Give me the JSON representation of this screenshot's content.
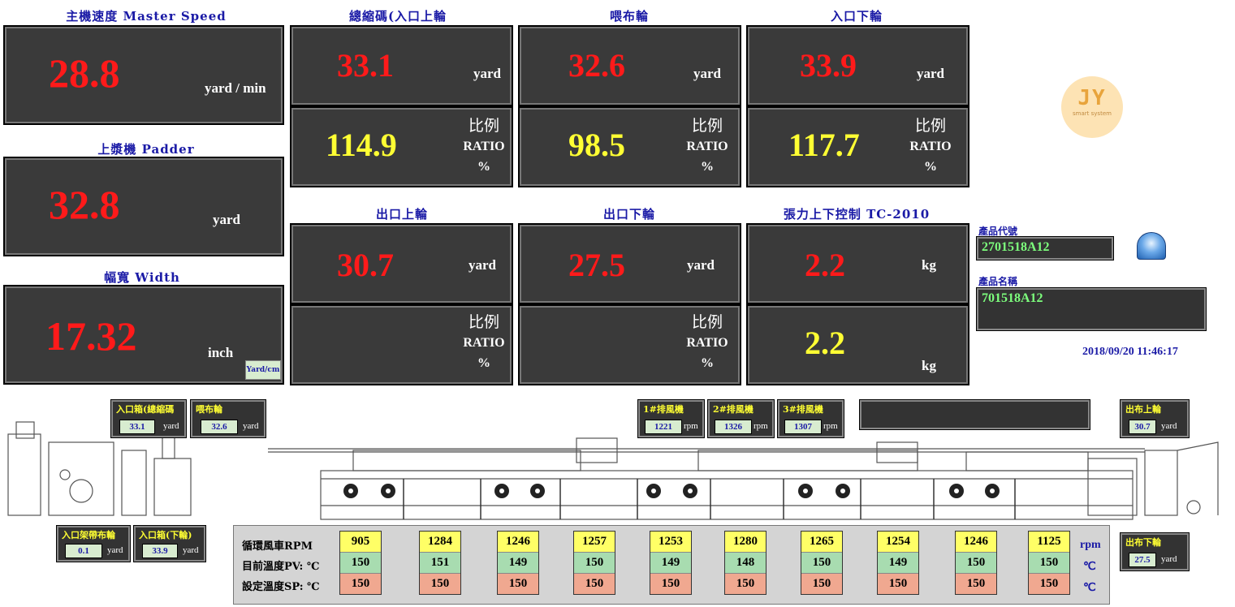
{
  "titles": {
    "master": "主機速度 Master Speed",
    "shrink": "總縮碼(入口上輪",
    "feed": "喂布輪",
    "inlet_lower": "入口下輪",
    "padder": "上漿機 Padder",
    "outlet_upper": "出口上輪",
    "outlet_lower": "出口下輪",
    "tension": "張力上下控制 TC-2010",
    "width": "幅寬 Width"
  },
  "master": {
    "value": "28.8",
    "unit": "yard / min"
  },
  "padder": {
    "value": "32.8",
    "unit": "yard"
  },
  "width": {
    "value": "17.32",
    "unit": "inch",
    "toggle": "Yard/cm"
  },
  "ratio_labels": {
    "zh": "比例",
    "en": "RATIO",
    "pct": "%"
  },
  "shrink": {
    "value": "33.1",
    "unit": "yard",
    "ratio": "114.9"
  },
  "feed": {
    "value": "32.6",
    "unit": "yard",
    "ratio": "98.5"
  },
  "inlet_lower": {
    "value": "33.9",
    "unit": "yard",
    "ratio": "117.7"
  },
  "outlet_upper": {
    "value": "30.7",
    "unit": "yard"
  },
  "outlet_lower": {
    "value": "27.5",
    "unit": "yard"
  },
  "tension": {
    "upper": "2.2",
    "upper_unit": "kg",
    "lower": "2.2",
    "lower_unit": "kg"
  },
  "product": {
    "code_label": "產品代號",
    "code": "2701518A12",
    "name_label": "產品名稱",
    "name": "701518A12",
    "datetime": "2018/09/20 11:46:17"
  },
  "logo": {
    "main": "JY",
    "sub": "smart system"
  },
  "small": {
    "inlet_box": {
      "title": "入口箱(總縮碼",
      "value": "33.1",
      "unit": "yard"
    },
    "feed_wheel": {
      "title": "喂布輪",
      "value": "32.6",
      "unit": "yard"
    },
    "fan1": {
      "title": "1#排風機",
      "value": "1221",
      "unit": "rpm"
    },
    "fan2": {
      "title": "2#排風機",
      "value": "1326",
      "unit": "rpm"
    },
    "fan3": {
      "title": "3#排風機",
      "value": "1307",
      "unit": "rpm"
    },
    "out_upper": {
      "title": "出布上輪",
      "value": "30.7",
      "unit": "yard"
    },
    "inlet_rack": {
      "title": "入口架帶布輪",
      "value": "0.1",
      "unit": "yard"
    },
    "inlet_lower_box": {
      "title": "入口箱(下輪)",
      "value": "33.9",
      "unit": "yard"
    },
    "out_lower": {
      "title": "出布下輪",
      "value": "27.5",
      "unit": "yard"
    }
  },
  "chambers": {
    "labels": {
      "rpm": "循環風車RPM",
      "pv": "目前溫度PV: ℃",
      "sp": "設定溫度SP: ℃"
    },
    "units": {
      "rpm": "rpm",
      "c1": "℃",
      "c2": "℃"
    },
    "columns": [
      {
        "rpm": "905",
        "pv": "150",
        "sp": "150"
      },
      {
        "rpm": "1284",
        "pv": "151",
        "sp": "150"
      },
      {
        "rpm": "1246",
        "pv": "149",
        "sp": "150"
      },
      {
        "rpm": "1257",
        "pv": "150",
        "sp": "150"
      },
      {
        "rpm": "1253",
        "pv": "149",
        "sp": "150"
      },
      {
        "rpm": "1280",
        "pv": "148",
        "sp": "150"
      },
      {
        "rpm": "1265",
        "pv": "150",
        "sp": "150"
      },
      {
        "rpm": "1254",
        "pv": "149",
        "sp": "150"
      },
      {
        "rpm": "1246",
        "pv": "150",
        "sp": "150"
      },
      {
        "rpm": "1125",
        "pv": "150",
        "sp": "150"
      }
    ]
  }
}
